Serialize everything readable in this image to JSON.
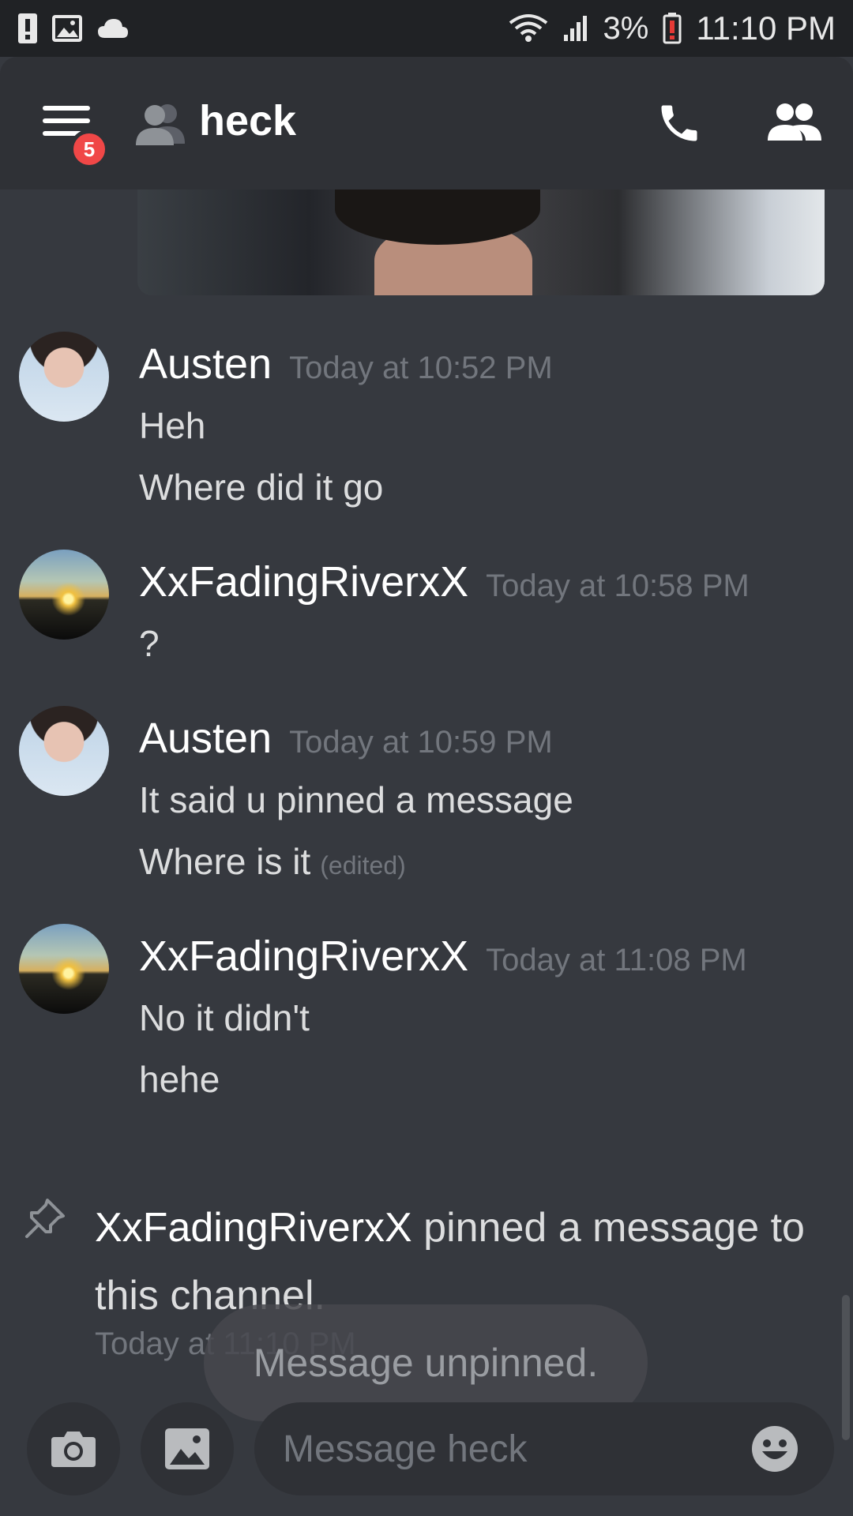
{
  "status_bar": {
    "battery_percent": "3%",
    "time": "11:10 PM"
  },
  "header": {
    "unread_badge": "5",
    "channel_name": "heck"
  },
  "messages": [
    {
      "author": "Austen",
      "timestamp": "Today at 10:52 PM",
      "avatar": "person",
      "lines": [
        "Heh",
        "Where did it go"
      ]
    },
    {
      "author": "XxFadingRiverxX",
      "timestamp": "Today at 10:58 PM",
      "avatar": "sunset",
      "lines": [
        "?"
      ]
    },
    {
      "author": "Austen",
      "timestamp": "Today at 10:59 PM",
      "avatar": "person",
      "lines": [
        "It said u pinned a message",
        "Where is it"
      ],
      "edited_label": "(edited)"
    },
    {
      "author": "XxFadingRiverxX",
      "timestamp": "Today at 11:08 PM",
      "avatar": "sunset",
      "lines": [
        "No it didn't",
        "hehe"
      ]
    }
  ],
  "pin_notice": {
    "author": "XxFadingRiverxX",
    "text": " pinned a message to this channel.",
    "timestamp": "Today at 11:10 PM"
  },
  "toast": "Message unpinned.",
  "composer": {
    "placeholder": "Message heck"
  },
  "colors": {
    "background": "#36393f",
    "header": "#2f3136",
    "badge": "#f04747",
    "muted": "#72767d"
  }
}
